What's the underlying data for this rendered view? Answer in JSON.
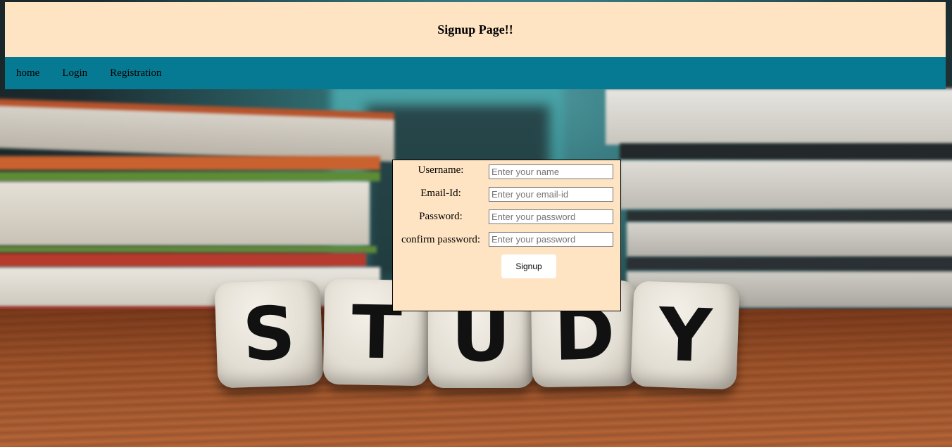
{
  "header": {
    "title": "Signup Page!!"
  },
  "nav": {
    "items": [
      {
        "label": "home"
      },
      {
        "label": "Login"
      },
      {
        "label": "Registration"
      }
    ]
  },
  "form": {
    "fields": [
      {
        "label": "Username:",
        "placeholder": "Enter your name",
        "value": ""
      },
      {
        "label": "Email-Id:",
        "placeholder": "Enter your email-id",
        "value": ""
      },
      {
        "label": "Password:",
        "placeholder": "Enter your password",
        "value": ""
      },
      {
        "label": "confirm password:",
        "placeholder": "Enter your password",
        "value": ""
      }
    ],
    "submit_label": "Signup"
  },
  "background": {
    "dice_letters": [
      "S",
      "T",
      "U",
      "D",
      "Y"
    ]
  },
  "colors": {
    "header_bg": "#ffe4c4",
    "nav_bg": "#077a93",
    "form_bg": "#ffe4c4"
  }
}
